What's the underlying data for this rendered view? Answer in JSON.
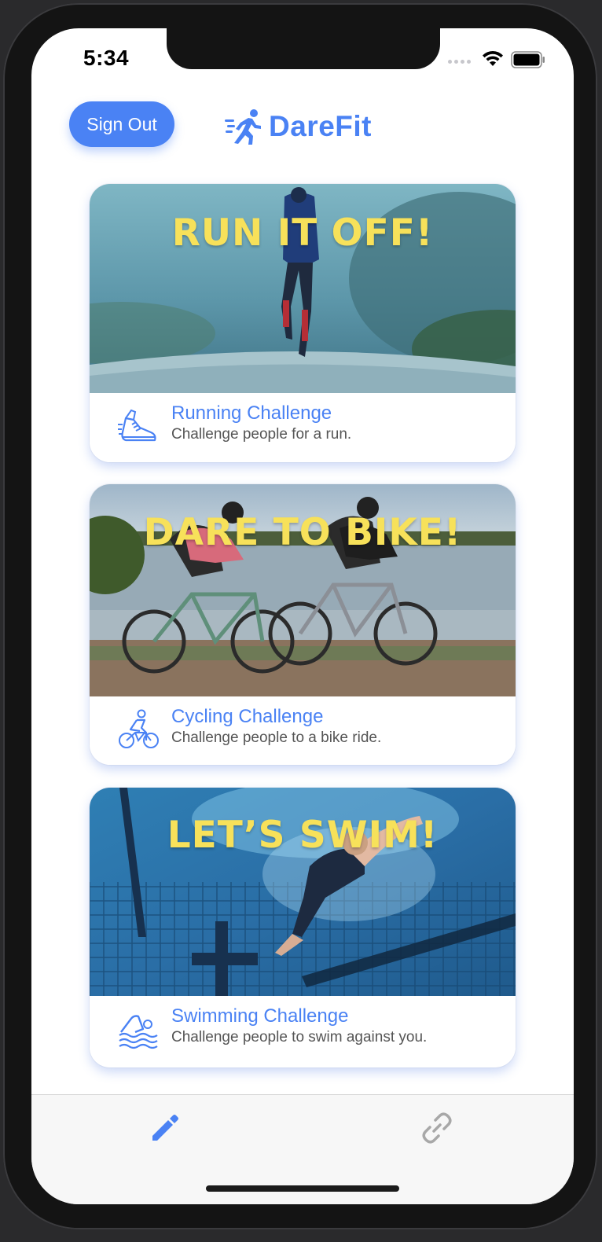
{
  "status_bar": {
    "time": "5:34"
  },
  "header": {
    "sign_out_label": "Sign Out",
    "logo_text": "DareFit"
  },
  "challenges": [
    {
      "headline": "RUN IT OFF!",
      "title": "Running Challenge",
      "subtitle": "Challenge people for a run.",
      "icon": "running-shoe-icon"
    },
    {
      "headline": "DARE TO BIKE!",
      "title": "Cycling Challenge",
      "subtitle": "Challenge people to a bike ride.",
      "icon": "cyclist-icon"
    },
    {
      "headline": "LET’S SWIM!",
      "title": "Swimming Challenge",
      "subtitle": "Challenge people to swim against you.",
      "icon": "swimmer-icon"
    }
  ],
  "tab_bar": {
    "tabs": [
      {
        "icon": "pencil-icon",
        "active": true
      },
      {
        "icon": "link-icon",
        "active": false
      }
    ]
  },
  "colors": {
    "accent": "#4a82f4",
    "headline": "#f7e15a",
    "tab_inactive": "#a8a8a8"
  }
}
